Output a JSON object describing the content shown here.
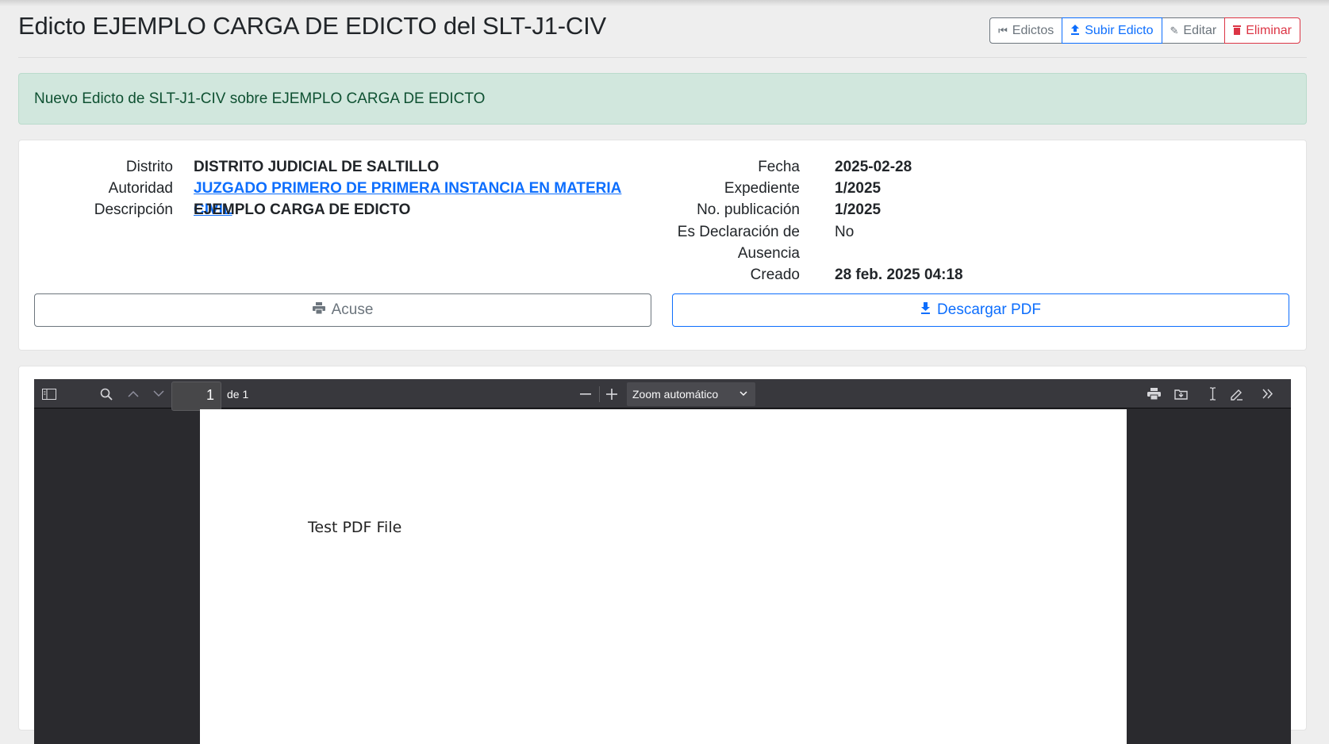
{
  "header": {
    "title": "Edicto EJEMPLO CARGA DE EDICTO del SLT-J1-CIV",
    "buttons": {
      "edictos": "Edictos",
      "subir": "Subir Edicto",
      "editar": "Editar",
      "eliminar": "Eliminar"
    }
  },
  "alert": {
    "message": "Nuevo Edicto de SLT-J1-CIV sobre EJEMPLO CARGA DE EDICTO"
  },
  "details": {
    "left": {
      "distrito_label": "Distrito",
      "distrito": "DISTRITO JUDICIAL DE SALTILLO",
      "autoridad_label": "Autoridad",
      "autoridad": "JUZGADO PRIMERO DE PRIMERA INSTANCIA EN MATERIA CIVIL",
      "descripcion_label": "Descripción",
      "descripcion": "EJEMPLO CARGA DE EDICTO"
    },
    "right": {
      "fecha_label": "Fecha",
      "fecha": "2025-02-28",
      "expediente_label": "Expediente",
      "expediente": "1/2025",
      "publicacion_label": "No. publicación",
      "publicacion": "1/2025",
      "declaracion_label_1": "Es Declaración de",
      "declaracion_label_2": "Ausencia",
      "declaracion": "No",
      "creado_label": "Creado",
      "creado": "28 feb. 2025 04:18"
    },
    "acuse_label": "Acuse",
    "descargar_label": "Descargar PDF"
  },
  "viewer": {
    "page_number": "1",
    "of_pages": "de 1",
    "zoom": "Zoom automático",
    "pdf_text": "Test PDF File"
  },
  "colors": {
    "primary": "#0d6efd",
    "danger": "#dc3545",
    "secondary": "#6c757d",
    "alert_bg": "#d1e7dd",
    "viewer_bg": "#2a2a2e"
  }
}
